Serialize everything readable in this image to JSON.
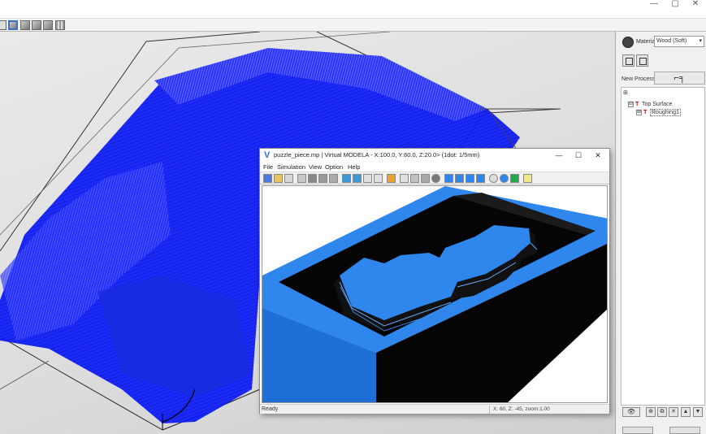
{
  "window": {
    "minimize_glyph": "—",
    "maximize_glyph": "▢",
    "close_glyph": "✕"
  },
  "right_panel": {
    "material_label": "Material",
    "material_value": "Wood (Soft)",
    "new_process_label": "New Process",
    "new_process_icon": "tool-icon",
    "tree": [
      {
        "expander": "⊟",
        "label": "Top Surface"
      },
      {
        "expander": "⊞",
        "label": "Roughing1"
      }
    ],
    "bottom_buttons": [
      "👁",
      "⊕",
      "⧉",
      "✕",
      "▲",
      "▼"
    ]
  },
  "vm": {
    "logo": "V",
    "title": "puzzle_piece.mp | Virtual MODELA - X:100.0, Y:60.0, Z:20.0> (1dot: 1/5mm)",
    "menus": [
      "File",
      "Simulation",
      "View",
      "Option",
      "Help"
    ],
    "status_left": "Ready",
    "status_right": "X: 60, Z: -45, zoom:1.00",
    "colors": {
      "part_blue": "#2f86ec",
      "part_side": "#1e6fd6",
      "shadow": "#050505"
    }
  }
}
